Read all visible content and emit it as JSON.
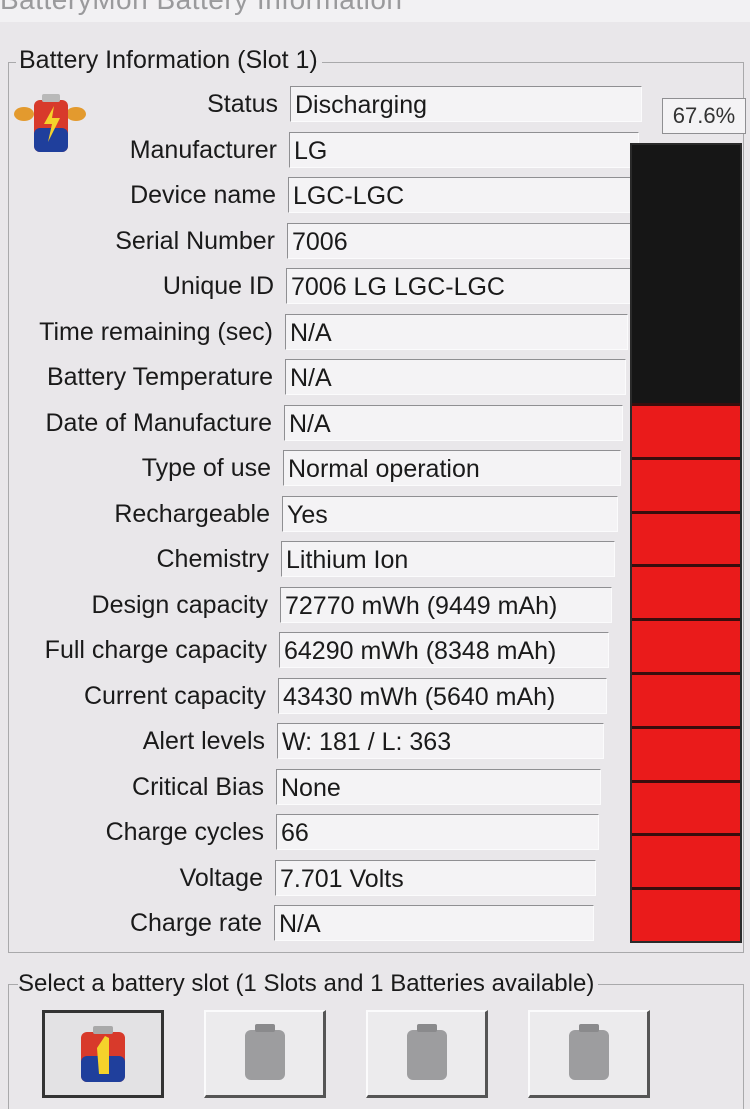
{
  "window": {
    "title": "BatteryMon Battery Information"
  },
  "group": {
    "title": "Battery Information (Slot 1)"
  },
  "fields": [
    {
      "label": "Status",
      "value": "Discharging"
    },
    {
      "label": "Manufacturer",
      "value": "LG"
    },
    {
      "label": "Device name",
      "value": "LGC-LGC"
    },
    {
      "label": "Serial Number",
      "value": "7006"
    },
    {
      "label": "Unique ID",
      "value": "7006 LG LGC-LGC"
    },
    {
      "label": "Time remaining (sec)",
      "value": "N/A"
    },
    {
      "label": "Battery Temperature",
      "value": "N/A"
    },
    {
      "label": "Date of Manufacture",
      "value": "N/A"
    },
    {
      "label": "Type of use",
      "value": "Normal operation"
    },
    {
      "label": "Rechargeable",
      "value": "Yes"
    },
    {
      "label": "Chemistry",
      "value": "Lithium Ion"
    },
    {
      "label": "Design capacity",
      "value": "72770 mWh (9449 mAh)"
    },
    {
      "label": "Full charge capacity",
      "value": "64290 mWh (8348 mAh)"
    },
    {
      "label": "Current capacity",
      "value": "43430 mWh (5640 mAh)"
    },
    {
      "label": "Alert levels",
      "value": "W: 181 / L: 363"
    },
    {
      "label": "Critical Bias",
      "value": "None"
    },
    {
      "label": "Charge cycles",
      "value": "66"
    },
    {
      "label": "Voltage",
      "value": "7.701 Volts"
    },
    {
      "label": "Charge rate",
      "value": "N/A"
    }
  ],
  "level": {
    "text": "67.6%",
    "fraction": 0.676,
    "fill_color": "#ea1b1b",
    "empty_color": "#161616"
  },
  "slots": {
    "caption": "Select a battery slot (1 Slots and 1 Batteries available)",
    "buttons": [
      {
        "state": "active",
        "icon": "battery-slot-1-icon"
      },
      {
        "state": "empty",
        "icon": "empty-battery-slot-icon"
      },
      {
        "state": "empty",
        "icon": "empty-battery-slot-icon"
      },
      {
        "state": "empty",
        "icon": "empty-battery-slot-icon"
      }
    ]
  }
}
